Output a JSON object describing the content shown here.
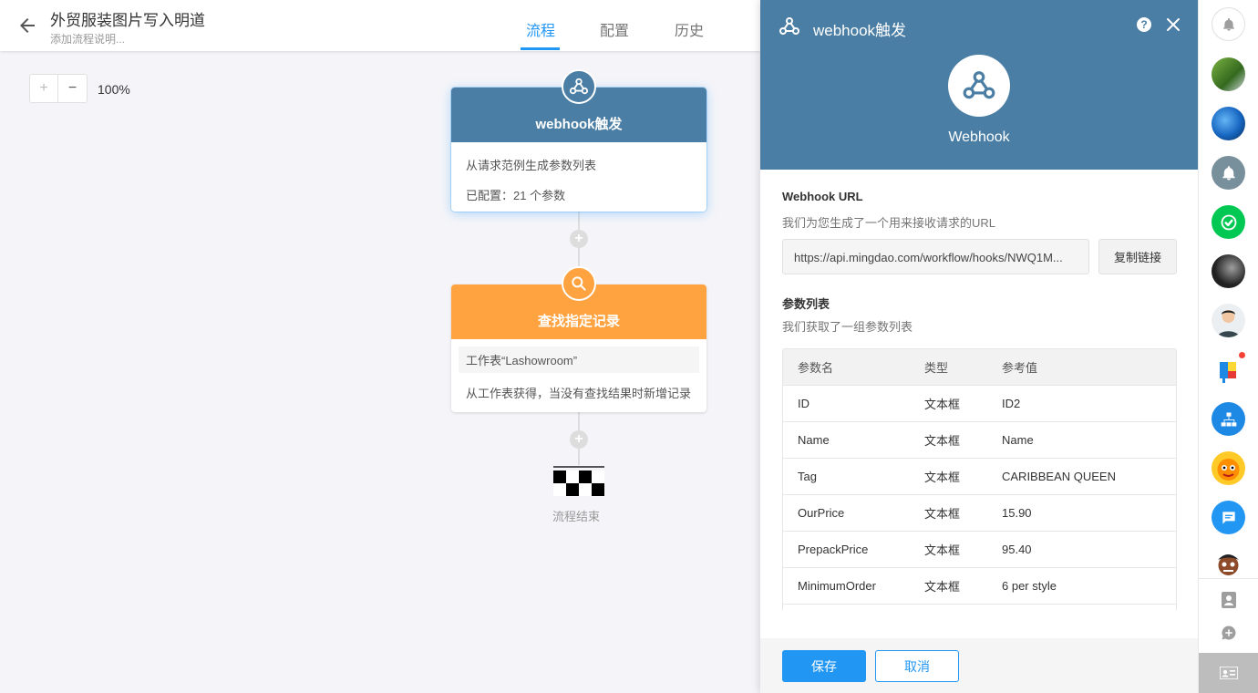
{
  "header": {
    "title": "外贸服装图片写入明道",
    "description": "添加流程说明...",
    "tabs": [
      {
        "label": "流程",
        "active": true
      },
      {
        "label": "配置",
        "active": false
      },
      {
        "label": "历史",
        "active": false
      }
    ]
  },
  "canvas": {
    "zoom_level": "100%",
    "nodes": [
      {
        "title": "webhook触发",
        "lines": [
          "从请求范例生成参数列表",
          "已配置：21 个参数"
        ],
        "color": "#4a7ea4",
        "icon": "webhook-icon"
      },
      {
        "title": "查找指定记录",
        "lines": [
          "工作表“Lashowroom”",
          "从工作表获得，当没有查找结果时新增记录"
        ],
        "color": "#ffa340",
        "icon": "search-icon"
      }
    ],
    "end_label": "流程结束"
  },
  "panel": {
    "title": "webhook触发",
    "icon_label": "Webhook",
    "accent": "#4a7ea4",
    "url_section": {
      "title": "Webhook URL",
      "desc": "我们为您生成了一个用来接收请求的URL",
      "url": "https://api.mingdao.com/workflow/hooks/NWQ1M...",
      "copy_label": "复制链接"
    },
    "params_section": {
      "title": "参数列表",
      "desc": "我们获取了一组参数列表",
      "headers": [
        "参数名",
        "类型",
        "参考值"
      ],
      "rows": [
        [
          "ID",
          "文本框",
          "ID2"
        ],
        [
          "Name",
          "文本框",
          "Name"
        ],
        [
          "Tag",
          "文本框",
          "CARIBBEAN QUEEN"
        ],
        [
          "OurPrice",
          "文本框",
          "15.90"
        ],
        [
          "PrepackPrice",
          "文本框",
          "95.40"
        ],
        [
          "MinimumOrder",
          "文本框",
          "6 per style"
        ]
      ]
    },
    "save_label": "保存",
    "cancel_label": "取消"
  },
  "colors": {
    "primary": "#2196f3",
    "webhook": "#4a7ea4",
    "search": "#ffa340"
  }
}
